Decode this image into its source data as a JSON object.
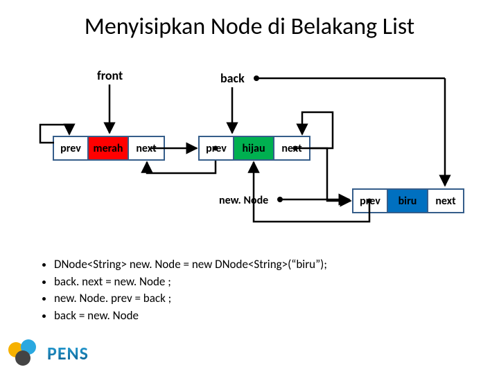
{
  "title": "Menyisipkan Node di Belakang List",
  "labels": {
    "front": "front",
    "back": "back",
    "newNode": "new. Node"
  },
  "node_cells": {
    "prev": "prev",
    "next": "next"
  },
  "nodes": {
    "merah": {
      "data": "merah",
      "color": "red"
    },
    "hijau": {
      "data": "hijau",
      "color": "green"
    },
    "biru": {
      "data": "biru",
      "color": "blue"
    }
  },
  "code": [
    "DNode<String> new. Node = new DNode<String>(“biru”);",
    "back. next = new. Node ;",
    "new. Node. prev = back ;",
    "back = new. Node"
  ],
  "logo_text": "PENS"
}
